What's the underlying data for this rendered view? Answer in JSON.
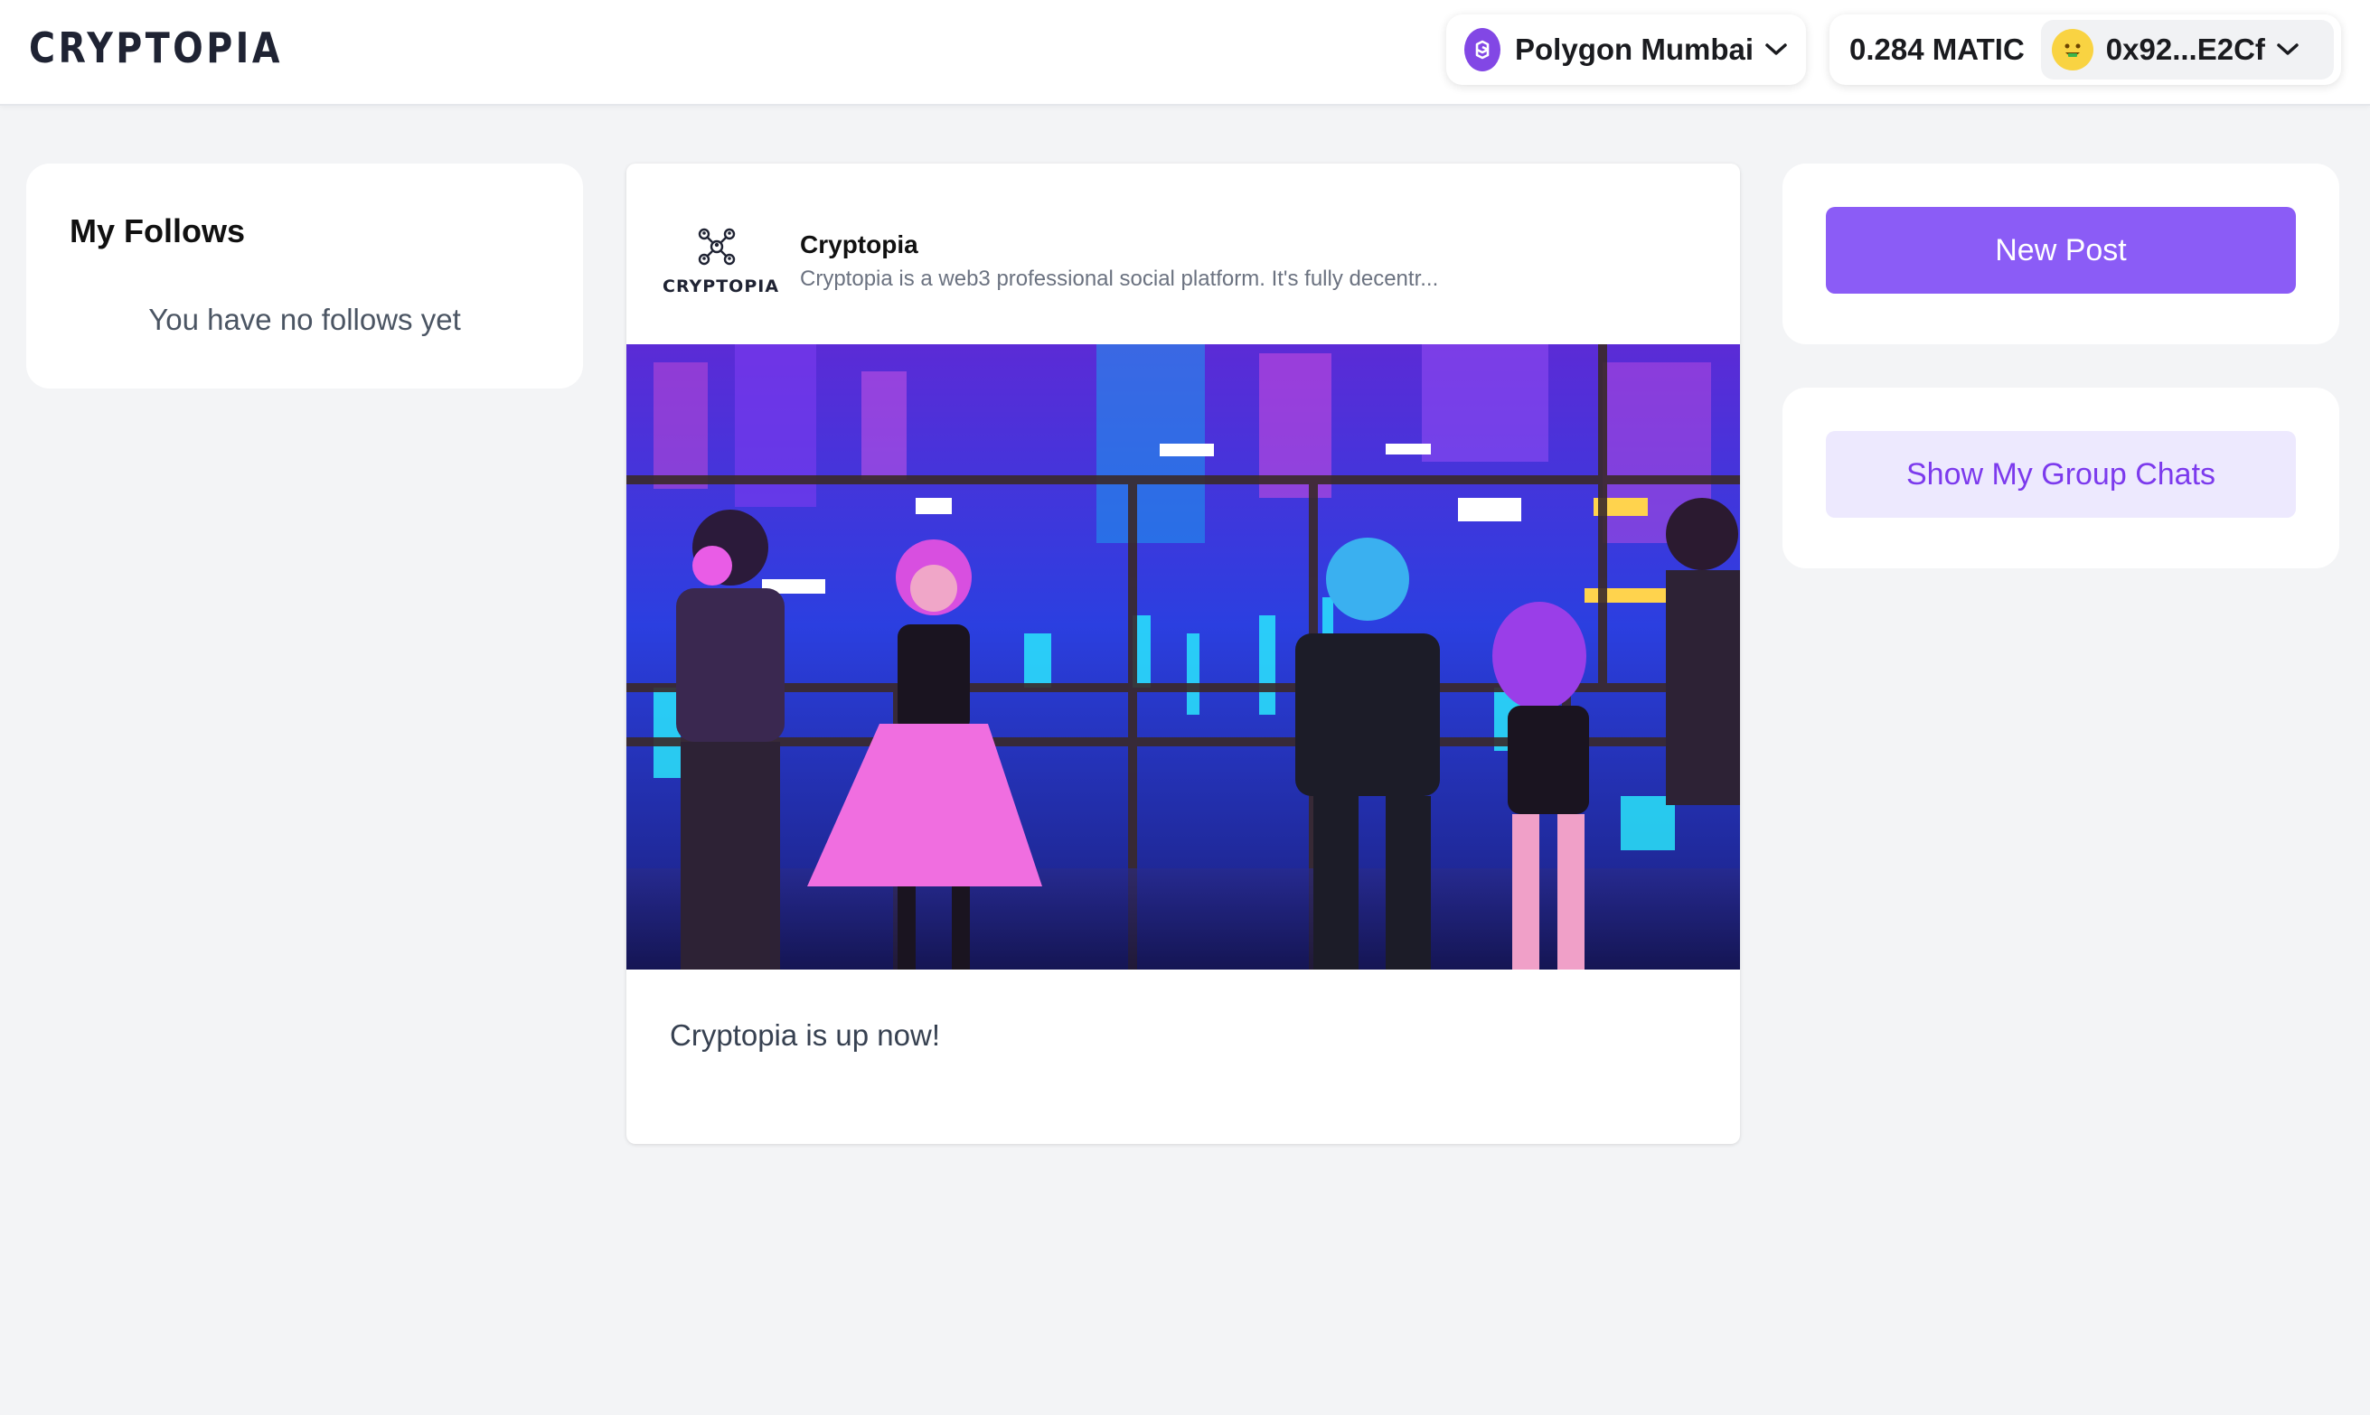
{
  "app": {
    "logo_text": "CRYPTOPIA"
  },
  "header": {
    "network": {
      "label": "Polygon Mumbai",
      "icon": "polygon-icon",
      "color": "#8247e5"
    },
    "account": {
      "balance": "0.284 MATIC",
      "address": "0x92...E2Cf",
      "avatar_icon": "emoji-avatar-icon"
    }
  },
  "follows": {
    "title": "My Follows",
    "empty_text": "You have no follows yet"
  },
  "post": {
    "author": "Cryptopia",
    "description": "Cryptopia is a web3 professional social platform. It's fully decentr...",
    "avatar_label": "CRYPTOPIA",
    "body": "Cryptopia is up now!",
    "image_icon": "neon-party-image"
  },
  "actions": {
    "new_post_label": "New Post",
    "group_chats_label": "Show My Group Chats"
  },
  "colors": {
    "accent": "#8b5cf6",
    "accent_light": "#ede9fe",
    "accent_text": "#7c3aed",
    "background": "#f3f4f6"
  }
}
